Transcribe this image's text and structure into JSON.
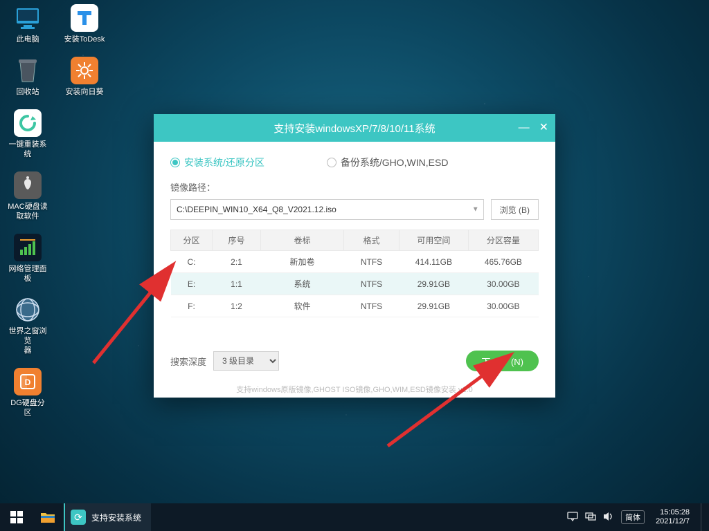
{
  "desktop": {
    "icons": [
      {
        "label": "此电脑"
      },
      {
        "label": "安装ToDesk"
      },
      {
        "label": "回收站"
      },
      {
        "label": "安装向日葵"
      },
      {
        "label": "一键重装系统"
      },
      {
        "label": "MAC硬盘读\n取软件"
      },
      {
        "label": "网络管理面板"
      },
      {
        "label": "世界之窗浏览\n器"
      },
      {
        "label": "DG硬盘分区"
      }
    ]
  },
  "installer": {
    "title": "支持安装windowsXP/7/8/10/11系统",
    "radio_install": "安装系统/还原分区",
    "radio_backup": "备份系统/GHO,WIN,ESD",
    "path_label": "镜像路径：",
    "path_value": "C:\\DEEPIN_WIN10_X64_Q8_V2021.12.iso",
    "browse": "浏览 (B)",
    "headers": {
      "part": "分区",
      "idx": "序号",
      "vol": "卷标",
      "fs": "格式",
      "free": "可用空间",
      "size": "分区容量"
    },
    "rows": [
      {
        "part": "C:",
        "idx": "2:1",
        "vol": "新加卷",
        "fs": "NTFS",
        "free": "414.11GB",
        "size": "465.76GB"
      },
      {
        "part": "E:",
        "idx": "1:1",
        "vol": "系统",
        "fs": "NTFS",
        "free": "29.91GB",
        "size": "30.00GB"
      },
      {
        "part": "F:",
        "idx": "1:2",
        "vol": "软件",
        "fs": "NTFS",
        "free": "29.91GB",
        "size": "30.00GB"
      }
    ],
    "search_depth_label": "搜索深度",
    "search_depth_value": "3 级目录",
    "next": "下一步 (N)",
    "support_text": "支持windows原版镜像,GHOST ISO镜像,GHO,WIM,ESD镜像安装     v1.0"
  },
  "taskbar": {
    "app_label": "支持安装系统",
    "ime": "简体",
    "time": "15:05:28",
    "date": "2021/12/7"
  }
}
